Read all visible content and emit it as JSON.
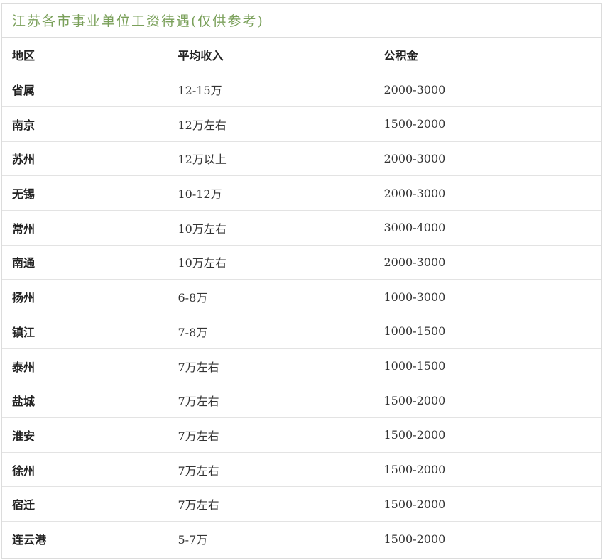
{
  "table_title": "江苏各市事业单位工资待遇(仅供参考)",
  "headers": [
    "地区",
    "平均收入",
    "公积金"
  ],
  "rows": [
    {
      "region": "省属",
      "income": "12-15万",
      "fund": "2000-3000"
    },
    {
      "region": "南京",
      "income": "12万左右",
      "fund": "1500-2000"
    },
    {
      "region": "苏州",
      "income": "12万以上",
      "fund": "2000-3000"
    },
    {
      "region": "无锡",
      "income": "10-12万",
      "fund": "2000-3000"
    },
    {
      "region": "常州",
      "income": "10万左右",
      "fund": "3000-4000"
    },
    {
      "region": "南通",
      "income": "10万左右",
      "fund": "2000-3000"
    },
    {
      "region": "扬州",
      "income": "6-8万",
      "fund": "1000-3000"
    },
    {
      "region": "镇江",
      "income": "7-8万",
      "fund": "1000-1500"
    },
    {
      "region": "泰州",
      "income": "7万左右",
      "fund": "1000-1500"
    },
    {
      "region": "盐城",
      "income": "7万左右",
      "fund": "1500-2000"
    },
    {
      "region": "淮安",
      "income": "7万左右",
      "fund": "1500-2000"
    },
    {
      "region": "徐州",
      "income": "7万左右",
      "fund": "1500-2000"
    },
    {
      "region": "宿迁",
      "income": "7万左右",
      "fund": "1500-2000"
    },
    {
      "region": "连云港",
      "income": "5-7万",
      "fund": "1500-2000"
    }
  ],
  "colors": {
    "title": "#7aa05a",
    "border": "#dcdcdc",
    "text": "#222222"
  }
}
